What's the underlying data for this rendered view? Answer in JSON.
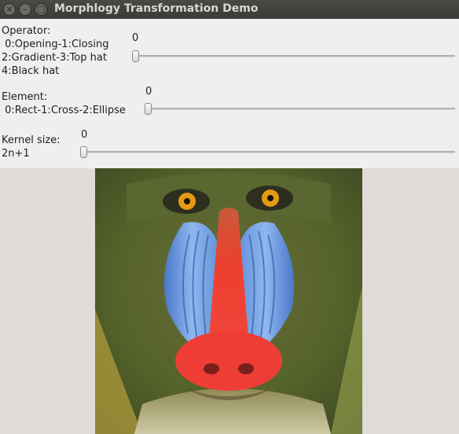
{
  "window": {
    "title": "Morphlogy Transformation Demo",
    "close_glyph": "×",
    "minimize_glyph": "–",
    "maximize_glyph": "□"
  },
  "trackbars": {
    "operator": {
      "label": "Operator:\n 0:Opening-1:Closing\n2:Gradient-3:Top hat\n4:Black hat",
      "value": "0"
    },
    "element": {
      "label": "Element:\n 0:Rect-1:Cross-2:Ellipse",
      "value": "0"
    },
    "kernel": {
      "label": "Kernel size:\n2n+1",
      "value": "0"
    }
  },
  "image": {
    "subject": "mandrill-face",
    "colors": {
      "fur": "#5e6a2e",
      "nose": "#e83c2c",
      "cheeks": "#6e9ee6",
      "eyes": "#e59a12"
    }
  }
}
